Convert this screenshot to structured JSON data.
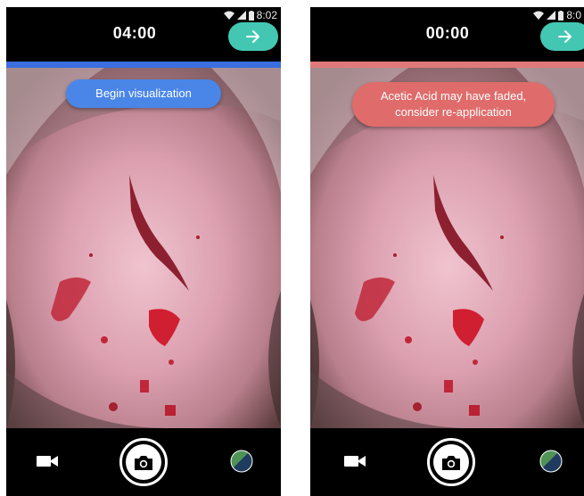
{
  "screens": [
    {
      "status_time": "8:02",
      "timer": "04:00",
      "banner": "Begin visualization",
      "progress_color": "#3b6fe0",
      "banner_color": "#4a86e8",
      "icons": [
        "wifi-icon",
        "signal-icon",
        "battery-icon",
        "arrow-right-icon",
        "video-camera-icon",
        "camera-icon",
        "color-filter-icon"
      ]
    },
    {
      "status_time": "8:0",
      "timer": "00:00",
      "banner_line1": "Acetic Acid may have faded,",
      "banner_line2": "consider re-application",
      "progress_color": "#e07a7a",
      "banner_color": "#e06b6b",
      "icons": [
        "wifi-icon",
        "signal-icon",
        "battery-icon",
        "arrow-right-icon",
        "video-camera-icon",
        "camera-icon",
        "color-filter-icon"
      ]
    }
  ],
  "accent_color": "#43c7b3"
}
